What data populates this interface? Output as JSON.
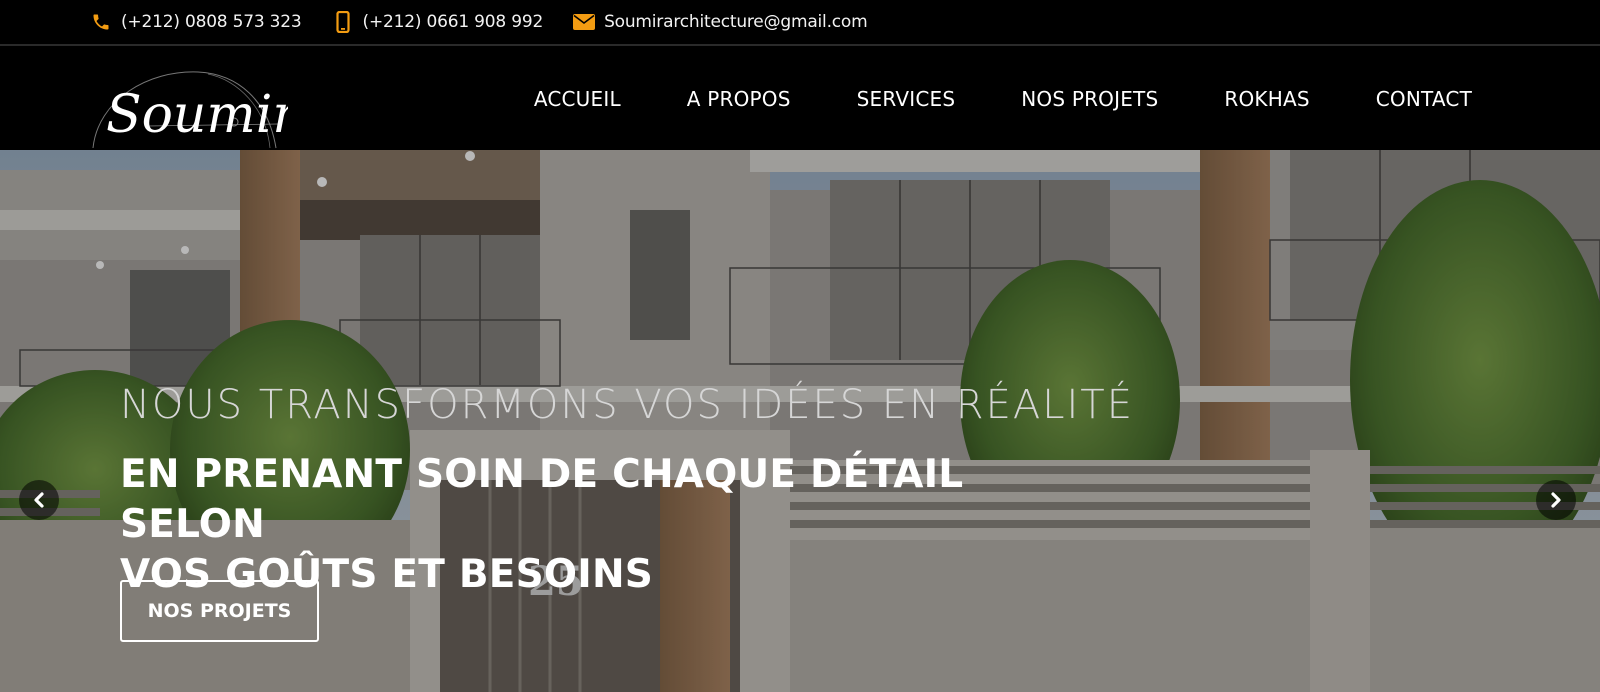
{
  "topbar": {
    "phone1": "(+212) 0808 573 323",
    "phone2": "(+212) 0661 908 992",
    "email": "Soumirarchitecture@gmail.com",
    "icons": [
      "phone-icon",
      "mobile-icon",
      "envelope-icon"
    ],
    "icon_color": "#f39c12"
  },
  "logo": {
    "text": "Soumir"
  },
  "nav": {
    "items": [
      "ACCUEIL",
      "A PROPOS",
      "SERVICES",
      "NOS PROJETS",
      "ROKHAS",
      "CONTACT"
    ]
  },
  "hero": {
    "subtitle": "NOUS TRANSFORMONS VOS IDÉES EN RÉALITÉ",
    "title_line1": "EN PRENANT SOIN DE CHAQUE DÉTAIL SELON",
    "title_line2": "VOS GOÛTS ET BESOINS",
    "button": "NOS PROJETS",
    "house_number": "25",
    "prev_icon": "chevron-left-icon",
    "next_icon": "chevron-right-icon"
  }
}
